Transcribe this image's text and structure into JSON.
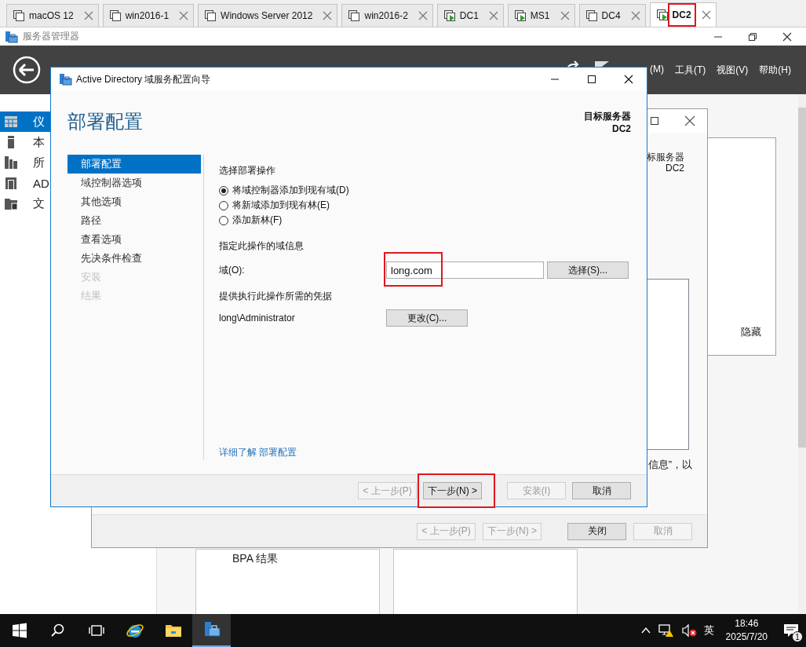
{
  "vm_tabs": [
    {
      "label": "macOS 12",
      "running": false,
      "selected": false,
      "highlighted": false
    },
    {
      "label": "win2016-1",
      "running": false,
      "selected": false,
      "highlighted": false
    },
    {
      "label": "Windows Server 2012",
      "running": false,
      "selected": false,
      "highlighted": false
    },
    {
      "label": "win2016-2",
      "running": false,
      "selected": false,
      "highlighted": false
    },
    {
      "label": "DC1",
      "running": true,
      "selected": false,
      "highlighted": false
    },
    {
      "label": "MS1",
      "running": true,
      "selected": false,
      "highlighted": false
    },
    {
      "label": "DC4",
      "running": false,
      "selected": false,
      "highlighted": false
    },
    {
      "label": "DC2",
      "running": true,
      "selected": true,
      "highlighted": true
    }
  ],
  "server_manager": {
    "title": "服务器管理器",
    "menu": [
      "(M)",
      "工具(T)",
      "视图(V)",
      "帮助(H)"
    ],
    "sidebar": [
      {
        "label": "仪",
        "selected": true
      },
      {
        "label": "本",
        "selected": false
      },
      {
        "label": "所",
        "selected": false
      },
      {
        "label": "AD",
        "selected": false
      },
      {
        "label": "文",
        "selected": false
      }
    ],
    "panel_link": "隐藏",
    "tiles": [
      "BPA 结果"
    ]
  },
  "back_wizard": {
    "target_label": "标服务器",
    "target_server": "DC2",
    "text_fragment": "信息”，以",
    "buttons": [
      {
        "label": "< 上一步(P)",
        "disabled": true
      },
      {
        "label": "下一步(N) >",
        "disabled": true
      },
      {
        "label": "关闭",
        "disabled": false
      },
      {
        "label": "取消",
        "disabled": true
      }
    ]
  },
  "dialog": {
    "title": "Active Directory 域服务配置向导",
    "heading": "部署配置",
    "target_label": "目标服务器",
    "target_server": "DC2",
    "steps": [
      {
        "label": "部署配置",
        "selected": true,
        "disabled": false
      },
      {
        "label": "域控制器选项",
        "selected": false,
        "disabled": false
      },
      {
        "label": "其他选项",
        "selected": false,
        "disabled": false
      },
      {
        "label": "路径",
        "selected": false,
        "disabled": false
      },
      {
        "label": "查看选项",
        "selected": false,
        "disabled": false
      },
      {
        "label": "先决条件检查",
        "selected": false,
        "disabled": false
      },
      {
        "label": "安装",
        "selected": false,
        "disabled": true
      },
      {
        "label": "结果",
        "selected": false,
        "disabled": true
      }
    ],
    "operation_label": "选择部署操作",
    "operations": [
      {
        "label": "将域控制器添加到现有域(D)",
        "selected": true
      },
      {
        "label": "将新域添加到现有林(E)",
        "selected": false
      },
      {
        "label": "添加新林(F)",
        "selected": false
      }
    ],
    "domain_section": "指定此操作的域信息",
    "domain_label": "域(O):",
    "domain_value": "long.com",
    "domain_highlighted": true,
    "select_button": "选择(S)...",
    "credentials_section": "提供执行此操作所需的凭据",
    "credentials_user": "long\\Administrator",
    "change_button": "更改(C)...",
    "learn_more": "详细了解 部署配置",
    "buttons": [
      {
        "label": "< 上一步(P)",
        "disabled": true,
        "highlighted": false
      },
      {
        "label": "下一步(N) >",
        "disabled": false,
        "highlighted": true
      },
      {
        "label": "安装(I)",
        "disabled": true,
        "highlighted": false
      },
      {
        "label": "取消",
        "disabled": false,
        "highlighted": false
      }
    ]
  },
  "taskbar": {
    "input_method": "英",
    "time": "18:46",
    "date": "2025/7/20",
    "notification_count": "1"
  }
}
